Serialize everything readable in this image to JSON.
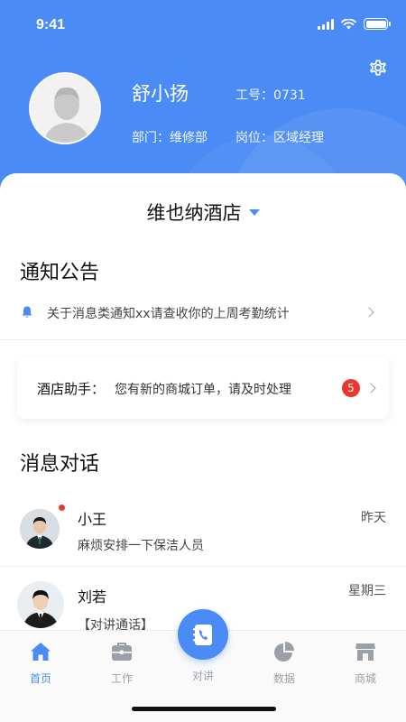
{
  "status_bar": {
    "time": "9:41"
  },
  "profile": {
    "name": "舒小扬",
    "staff_no": "工号：0731",
    "department": "部门：维修部",
    "position": "岗位：区域经理"
  },
  "hotel": {
    "name": "维也纳酒店"
  },
  "notice": {
    "section_title": "通知公告",
    "item_text": "关于消息类通知xx请查收你的上周考勤统计"
  },
  "assistant": {
    "label": "酒店助手：",
    "message": "您有新的商城订单，请及时处理",
    "badge_count": "5"
  },
  "messages": {
    "section_title": "消息对话",
    "items": [
      {
        "name": "小王",
        "time": "昨天",
        "preview": "麻烦安排一下保洁人员",
        "unread": true
      },
      {
        "name": "刘若",
        "time": "星期三",
        "preview": "【对讲通话】",
        "unread": false
      }
    ]
  },
  "tabbar": {
    "tabs": [
      {
        "label": "首页",
        "icon": "home-icon",
        "active": true
      },
      {
        "label": "工作",
        "icon": "briefcase-icon",
        "active": false
      },
      {
        "label": "对讲",
        "icon": "phone-book-icon",
        "active": false
      },
      {
        "label": "数据",
        "icon": "pie-chart-icon",
        "active": false
      },
      {
        "label": "商城",
        "icon": "store-icon",
        "active": false
      }
    ]
  },
  "colors": {
    "primary": "#4a8bf5",
    "badge_red": "#e8392e",
    "tab_inactive": "#9aa0a8"
  }
}
